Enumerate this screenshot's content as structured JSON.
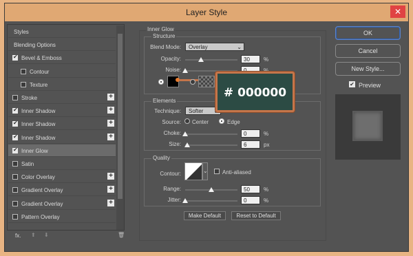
{
  "title": "Layer Style",
  "close_glyph": "✕",
  "sidebar": {
    "items": [
      {
        "label": "Styles",
        "checkbox": false,
        "plus": false,
        "checked": false
      },
      {
        "label": "Blending Options",
        "checkbox": false,
        "plus": false,
        "checked": false
      },
      {
        "label": "Bevel & Emboss",
        "checkbox": true,
        "plus": false,
        "checked": true
      },
      {
        "label": "Contour",
        "checkbox": true,
        "plus": false,
        "checked": false
      },
      {
        "label": "Texture",
        "checkbox": true,
        "plus": false,
        "checked": false
      },
      {
        "label": "Stroke",
        "checkbox": true,
        "plus": true,
        "checked": false
      },
      {
        "label": "Inner Shadow",
        "checkbox": true,
        "plus": true,
        "checked": true
      },
      {
        "label": "Inner Shadow",
        "checkbox": true,
        "plus": true,
        "checked": true
      },
      {
        "label": "Inner Shadow",
        "checkbox": true,
        "plus": true,
        "checked": true
      },
      {
        "label": "Inner Glow",
        "checkbox": true,
        "plus": false,
        "checked": true
      },
      {
        "label": "Satin",
        "checkbox": true,
        "plus": false,
        "checked": false
      },
      {
        "label": "Color Overlay",
        "checkbox": true,
        "plus": true,
        "checked": false
      },
      {
        "label": "Gradient Overlay",
        "checkbox": true,
        "plus": true,
        "checked": false
      },
      {
        "label": "Gradient Overlay",
        "checkbox": true,
        "plus": true,
        "checked": false
      },
      {
        "label": "Pattern Overlay",
        "checkbox": true,
        "plus": false,
        "checked": false
      }
    ],
    "selected_index": 9,
    "footer": {
      "fx": "fx.",
      "up": "⬆",
      "down": "⬇",
      "trash": "🗑"
    }
  },
  "inner_glow": {
    "section_title": "Inner Glow",
    "structure": {
      "title": "Structure",
      "blend_mode_label": "Blend Mode:",
      "blend_mode_value": "Overlay",
      "opacity_label": "Opacity:",
      "opacity_value": "30",
      "opacity_unit": "%",
      "opacity_level": 30,
      "noise_label": "Noise:",
      "noise_value": "0",
      "noise_unit": "%",
      "noise_level": 0
    },
    "elements": {
      "title": "Elements",
      "technique_label": "Technique:",
      "technique_value": "Softer",
      "source_label": "Source:",
      "source_center": "Center",
      "source_edge": "Edge",
      "choke_label": "Choke:",
      "choke_value": "0",
      "choke_unit": "%",
      "size_label": "Size:",
      "size_value": "6",
      "size_unit": "px"
    },
    "quality": {
      "title": "Quality",
      "contour_label": "Contour:",
      "anti_aliased": "Anti-aliased",
      "range_label": "Range:",
      "range_value": "50",
      "range_unit": "%",
      "range_level": 50,
      "jitter_label": "Jitter:",
      "jitter_value": "0",
      "jitter_unit": "%",
      "jitter_level": 0
    },
    "make_default": "Make Default",
    "reset_default": "Reset to Default"
  },
  "buttons": {
    "ok": "OK",
    "cancel": "Cancel",
    "new_style": "New Style..."
  },
  "preview_label": "Preview",
  "callout": "# 000000",
  "colors": {
    "glow_color": "#000000",
    "callout_bg": "#2c4b44",
    "callout_border": "#c5754a"
  }
}
